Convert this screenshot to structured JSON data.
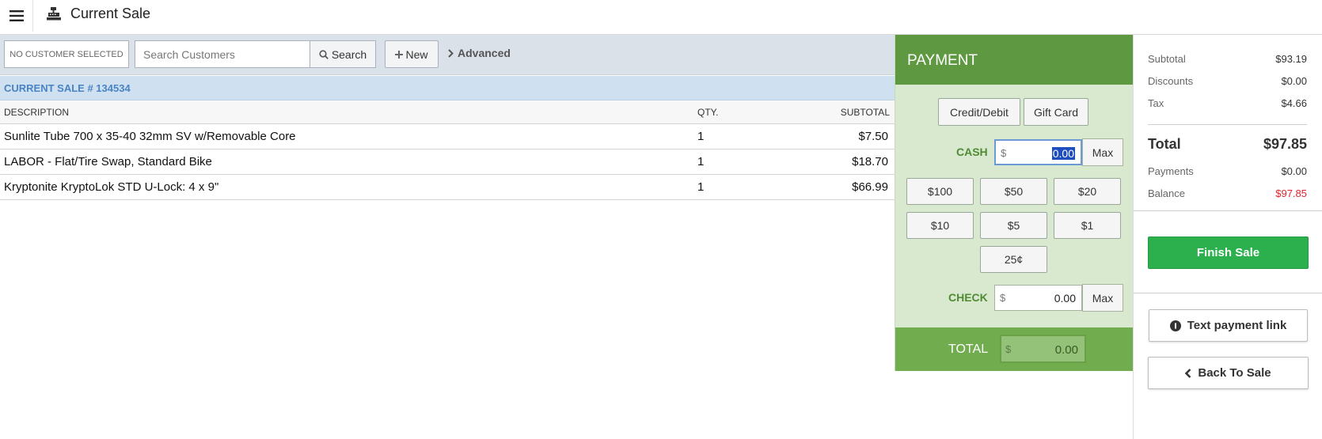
{
  "header": {
    "title": "Current Sale",
    "menu_icon": "hamburger-menu-icon",
    "register_icon": "cash-register-icon"
  },
  "customer_bar": {
    "no_customer": "NO CUSTOMER SELECTED",
    "search_placeholder": "Search Customers",
    "search_label": "Search",
    "new_label": "New",
    "advanced_label": "Advanced"
  },
  "sale": {
    "header": "CURRENT SALE # 134534",
    "columns": {
      "description": "DESCRIPTION",
      "qty": "QTY.",
      "subtotal": "SUBTOTAL"
    },
    "items": [
      {
        "description": "Sunlite Tube 700 x 35-40 32mm SV w/Removable Core",
        "qty": "1",
        "subtotal": "$7.50"
      },
      {
        "description": "LABOR - Flat/Tire Swap, Standard Bike",
        "qty": "1",
        "subtotal": "$18.70"
      },
      {
        "description": "Kryptonite KryptoLok STD U-Lock: 4 x 9\"",
        "qty": "1",
        "subtotal": "$66.99"
      }
    ]
  },
  "payment": {
    "title": "PAYMENT",
    "methods": [
      "Credit/Debit",
      "Gift Card"
    ],
    "cash_label": "CASH",
    "check_label": "CHECK",
    "currency": "$",
    "cash_value": "0.00",
    "check_value": "0.00",
    "max_label": "Max",
    "quick_amounts": [
      "$100",
      "$50",
      "$20",
      "$10",
      "$5",
      "$1",
      "25¢"
    ],
    "total_label": "TOTAL",
    "total_value": "0.00"
  },
  "summary": {
    "subtotal_label": "Subtotal",
    "subtotal": "$93.19",
    "discounts_label": "Discounts",
    "discounts": "$0.00",
    "tax_label": "Tax",
    "tax": "$4.66",
    "total_label": "Total",
    "total": "$97.85",
    "payments_label": "Payments",
    "payments": "$0.00",
    "balance_label": "Balance",
    "balance": "$97.85",
    "finish_label": "Finish Sale",
    "text_link_label": "Text payment link",
    "back_label": "Back To Sale"
  },
  "colors": {
    "payment_green": "#5e9941",
    "finish_green": "#2cb04d",
    "balance_red": "#e0242f",
    "sale_header_blue": "#4a84c4"
  }
}
